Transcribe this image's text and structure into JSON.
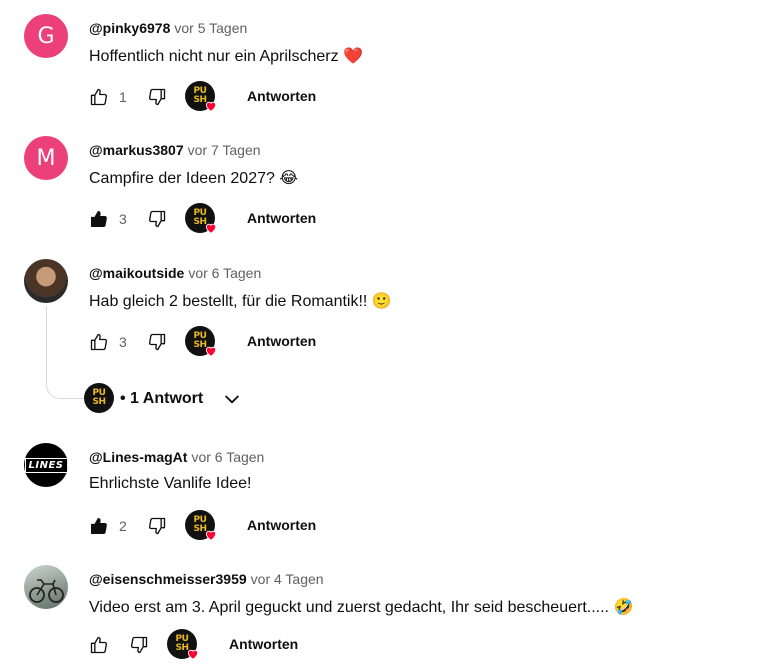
{
  "comments": [
    {
      "author": "@pinky6978",
      "time": "vor 5 Tagen",
      "text": "Hoffentlich nicht nur ein Aprilscherz ❤️",
      "likes": "1",
      "avatar_letter": "G",
      "liked": false,
      "reply_label": "Antworten"
    },
    {
      "author": "@markus3807",
      "time": "vor 7 Tagen",
      "text": "Campfire der Ideen 2027? 😂",
      "likes": "3",
      "avatar_letter": "M",
      "liked": true,
      "reply_label": "Antworten"
    },
    {
      "author": "@maikoutside",
      "time": "vor 6 Tagen",
      "text": "Hab gleich 2 bestellt, für die Romantik!! 🙂",
      "likes": "3",
      "liked": false,
      "reply_label": "Antworten"
    },
    {
      "author": "@Lines-magAt",
      "time": "vor 6 Tagen",
      "text": "Ehrlichste Vanlife Idee!",
      "likes": "2",
      "avatar_logo": "LINES",
      "liked": true,
      "reply_label": "Antworten"
    },
    {
      "author": "@eisenschmeisser3959",
      "time": "vor 4 Tagen",
      "text": "Video erst am 3. April geguckt und zuerst gedacht, Ihr seid bescheuert..... 🤣",
      "likes": "",
      "liked": false,
      "reply_label": "Antworten"
    }
  ],
  "replies_toggle": {
    "label": "• 1 Antwort"
  },
  "creator_badge": {
    "line1": "PU",
    "line2": "SH"
  },
  "icons": {
    "like": "thumb-up-icon",
    "like_filled": "thumb-up-filled-icon",
    "dislike": "thumb-down-icon",
    "heart": "heart-icon",
    "chevron": "chevron-down-icon"
  },
  "colors": {
    "avatar_pink": "#ec407a",
    "heart": "#ff0033",
    "badge_gold": "#e8b923",
    "muted": "#606060"
  }
}
